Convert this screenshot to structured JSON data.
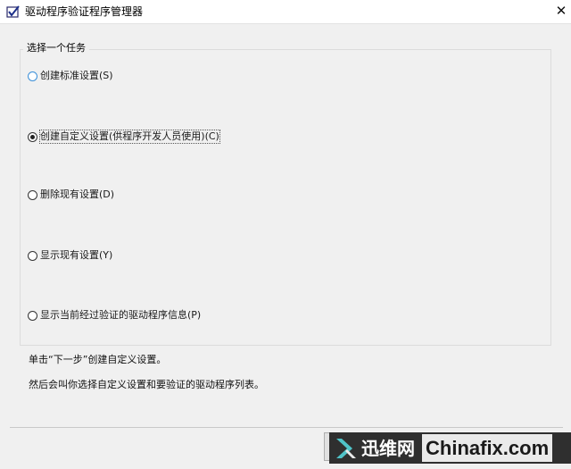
{
  "window": {
    "title": "驱动程序验证程序管理器",
    "app_icon": "verifier-check-icon",
    "close_glyph": "✕"
  },
  "task_group": {
    "legend": "选择一个任务",
    "options": [
      {
        "label": "创建标准设置(S)",
        "selected": false
      },
      {
        "label": "创建自定义设置(供程序开发人员使用)(C)",
        "selected": true
      },
      {
        "label": "删除现有设置(D)",
        "selected": false
      },
      {
        "label": "显示现有设置(Y)",
        "selected": false
      },
      {
        "label": "显示当前经过验证的驱动程序信息(P)",
        "selected": false
      }
    ]
  },
  "hints": {
    "line1": "单击“下一步”创建自定义设置。",
    "line2": "然后会叫你选择自定义设置和要验证的驱动程序列表。"
  },
  "watermark": {
    "cn_text": "迅维网",
    "en_text": "Chinafix.com",
    "logo_color": "#4fc3c8"
  }
}
